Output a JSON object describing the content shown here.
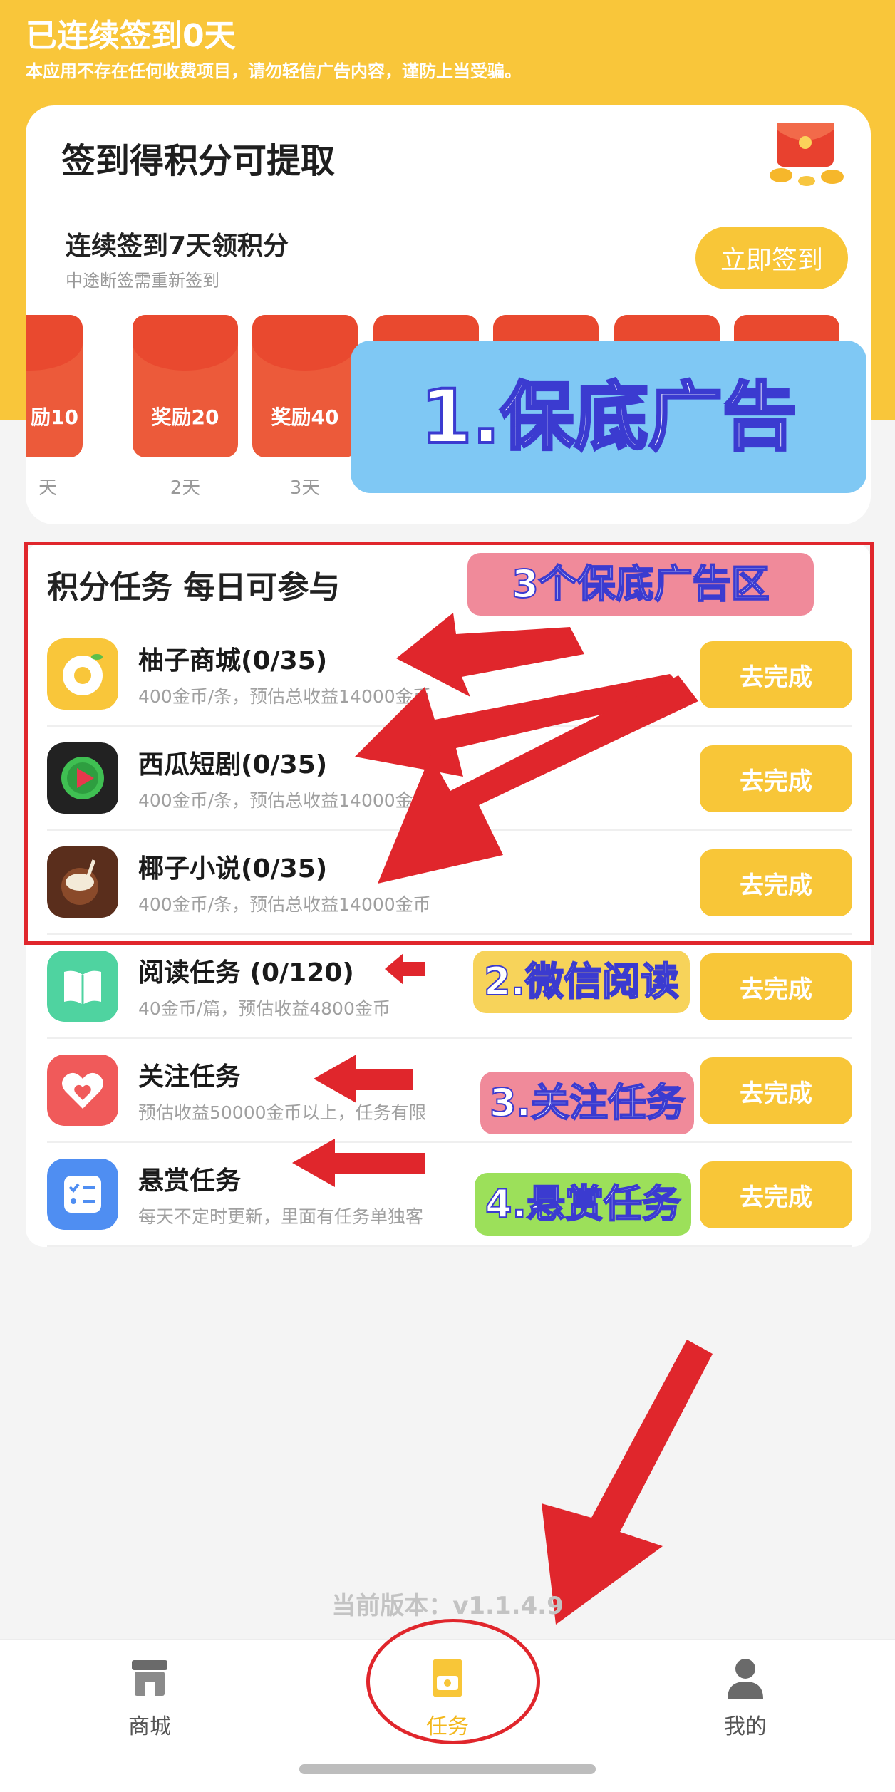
{
  "header": {
    "streak_title": "已连续签到0天",
    "disclaimer": "本应用不存在任何收费项目，请勿轻信广告内容，谨防上当受骗。"
  },
  "signin_card": {
    "title": "签到得积分可提取",
    "streak_label": "连续签到7天领积分",
    "streak_hint": "中途断签需重新签到",
    "button_label": "立即签到",
    "days": [
      {
        "reward": "励10",
        "day": "天"
      },
      {
        "reward": "奖励20",
        "day": "2天"
      },
      {
        "reward": "奖励40",
        "day": "3天"
      },
      {
        "reward": "",
        "day": ""
      },
      {
        "reward": "",
        "day": ""
      },
      {
        "reward": "",
        "day": ""
      },
      {
        "reward": "",
        "day": ""
      }
    ]
  },
  "annotations": {
    "ad_label": "1.保底广告",
    "ad_zone_label": "3个保底广告区",
    "wechat_label": "2.微信阅读",
    "follow_label": "3.关注任务",
    "bounty_label": "4.悬赏任务"
  },
  "tasks": {
    "section_title": "积分任务  每日可参与",
    "items": [
      {
        "name": "柚子商城(0/35)",
        "desc": "400金币/条，预估总收益14000金币",
        "button": "去完成",
        "icon": "orange-circle-icon"
      },
      {
        "name": "西瓜短剧(0/35)",
        "desc": "400金币/条，预估总收益14000金币",
        "button": "去完成",
        "icon": "play-icon"
      },
      {
        "name": "椰子小说(0/35)",
        "desc": "400金币/条，预估总收益14000金币",
        "button": "去完成",
        "icon": "coconut-icon"
      },
      {
        "name": "阅读任务 (0/120)",
        "desc": "40金币/篇，预估收益4800金币",
        "button": "去完成",
        "icon": "book-icon"
      },
      {
        "name": "关注任务",
        "desc": "预估收益50000金币以上，任务有限",
        "button": "去完成",
        "icon": "heart-icon"
      },
      {
        "name": "悬赏任务",
        "desc": "每天不定时更新，里面有任务单独客",
        "button": "去完成",
        "icon": "checklist-icon"
      }
    ]
  },
  "version": "当前版本：v1.1.4.9",
  "bottom_nav": {
    "items": [
      {
        "label": "商城",
        "icon": "store-icon"
      },
      {
        "label": "任务",
        "icon": "task-icon"
      },
      {
        "label": "我的",
        "icon": "user-icon"
      }
    ]
  },
  "colors": {
    "brand_yellow": "#f9c63a",
    "button_yellow": "#f8c638",
    "annotation_red": "#e0262c",
    "red_packet": "#ec5a3a"
  }
}
